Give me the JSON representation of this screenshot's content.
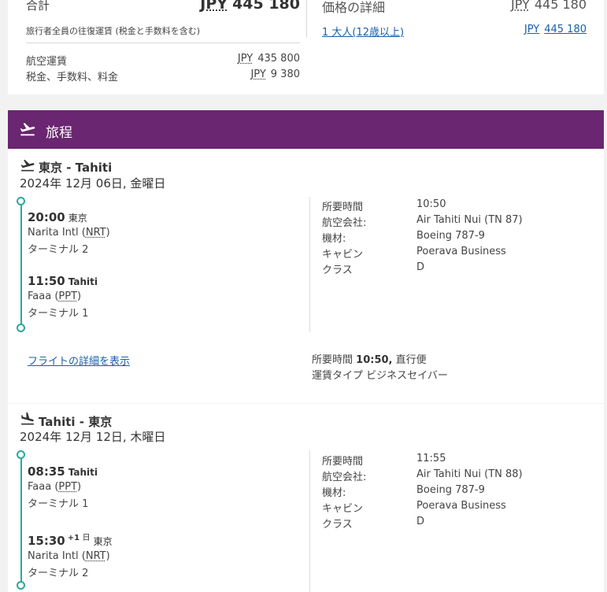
{
  "price": {
    "total_label": "合計",
    "currency": "JPY",
    "total_amount": "445 180",
    "total_note": "旅行者全員の往復運賃 (税金と手数料を含む)",
    "lines": [
      {
        "label": "航空運賃",
        "currency": "JPY",
        "amount": "435 800"
      },
      {
        "label": "税金、手数料、料金",
        "currency": "JPY",
        "amount": "9 380"
      }
    ],
    "details_title": "価格の詳細",
    "details_currency": "JPY",
    "details_amount": "445 180",
    "passenger_link": "1 大人(12歳以上)",
    "passenger_currency": "JPY",
    "passenger_amount": "445 180"
  },
  "itinerary": {
    "title": "旅程",
    "icon": "plane-takeoff-icon",
    "accent_color": "#6a2670",
    "timeline_color": "#28a99e",
    "link_color": "#1a5fa8"
  },
  "outbound": {
    "icon": "plane-takeoff-icon",
    "route": "東京 - Tahiti",
    "date": "2024年 12月 06日, 金曜日",
    "departure": {
      "time": "20:00",
      "city": "東京",
      "airport_name": "Narita Intl",
      "airport_code": "NRT",
      "terminal": "ターミナル 2"
    },
    "arrival": {
      "time": "11:50",
      "city": "Tahiti",
      "airport_name": "Faaa",
      "airport_code": "PPT",
      "terminal": "ターミナル 1"
    },
    "info": [
      {
        "label": "所要時間",
        "value": "10:50"
      },
      {
        "label": "航空会社:",
        "value": "Air Tahiti Nui (TN 87)"
      },
      {
        "label": "機材:",
        "value": "Boeing 787-9"
      },
      {
        "label": "キャビン",
        "value": "Poerava Business"
      },
      {
        "label": "クラス",
        "value": "D"
      }
    ],
    "details_link": "フライトの詳細を表示",
    "summary_duration_label": "所要時間",
    "summary_duration": "10:50,",
    "summary_stops": "直行便",
    "summary_fare_label": "運賃タイプ",
    "summary_fare": "ビジネスセイバー"
  },
  "return": {
    "icon": "plane-landing-icon",
    "route": "Tahiti - 東京",
    "date": "2024年 12月 12日, 木曜日",
    "departure": {
      "time": "08:35",
      "city": "Tahiti",
      "airport_name": "Faaa",
      "airport_code": "PPT",
      "terminal": "ターミナル 1"
    },
    "arrival": {
      "time": "15:30",
      "day_offset": "+1",
      "day_label": "日",
      "city": "東京",
      "airport_name": "Narita Intl",
      "airport_code": "NRT",
      "terminal": "ターミナル 2"
    },
    "info": [
      {
        "label": "所要時間",
        "value": "11:55"
      },
      {
        "label": "航空会社:",
        "value": "Air Tahiti Nui (TN 88)"
      },
      {
        "label": "機材:",
        "value": "Boeing 787-9"
      },
      {
        "label": "キャビン",
        "value": "Poerava Business"
      },
      {
        "label": "クラス",
        "value": "D"
      }
    ]
  }
}
